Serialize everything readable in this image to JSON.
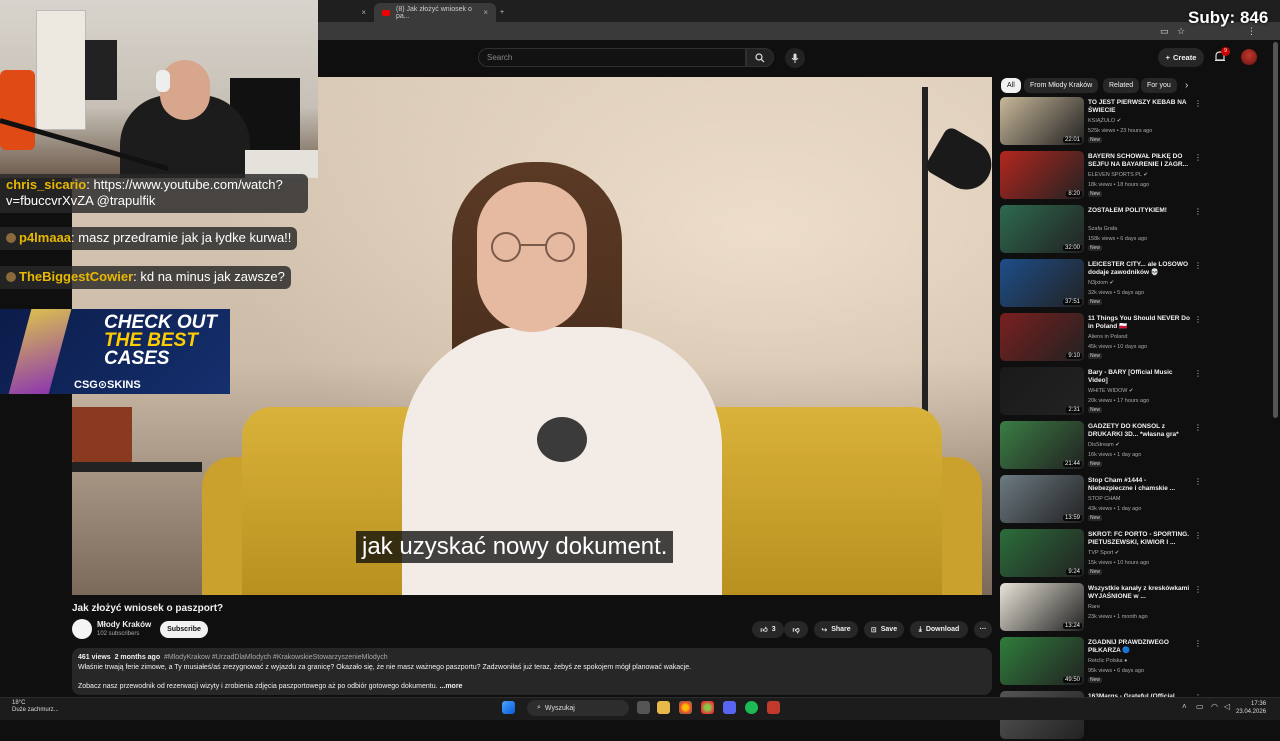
{
  "browser": {
    "tab_active_title": "(8) Jak złożyć wniosek o pa...",
    "tab_close": "×",
    "new_tab": "+"
  },
  "overlay": {
    "subs_counter": "Suby: 846"
  },
  "header": {
    "search_placeholder": "Search",
    "create_label": "Create",
    "notifications_count": "9"
  },
  "video": {
    "subtitle": "jak uzyskać nowy dokument.",
    "title": "Jak złożyć wniosek o paszport?",
    "channel_name": "Młody Kraków",
    "channel_subs": "102 subscribers",
    "subscribe_label": "Subscribe",
    "likes": "3",
    "share_label": "Share",
    "save_label": "Save",
    "download_label": "Download",
    "more_label": "···"
  },
  "description": {
    "views": "461 views",
    "age": "2 months ago",
    "tags": "#MlodyKrakow #UrzadDlaMlodych #KrakowskieStowarzyszenieMlodych",
    "line1": "Właśnie trwają ferie zimowe, a Ty musiałeś/aś zrezygnować z wyjazdu za granicę? Okazało się, że nie masz ważnego paszportu? Zadzwoniłaś już teraz, żebyś ze spokojem mógł planować wakacje.",
    "line2": "Zobacz nasz przewodnik od rezerwacji wizyty i zrobienia zdjęcia paszportowego aż po odbiór gotowego dokumentu.",
    "more": "...more"
  },
  "chat": [
    {
      "user": "chris_sicario",
      "text": ": https://www.youtube.com/watch?v=fbuccvrXvZA @trapulfik"
    },
    {
      "user": "p4lmaaa",
      "text": ": masz przedramie jak ja łydke kurwa!!"
    },
    {
      "user": "TheBiggestCowier",
      "text": ": kd na minus jak zawsze?"
    }
  ],
  "ad": {
    "line1": "CHECK OUT",
    "line2": "THE BEST",
    "line3": "CASES",
    "logo": "CSG⊙SKINS"
  },
  "sidebar": {
    "chips": [
      "All",
      "From Młody Kraków",
      "Related",
      "For you"
    ],
    "videos": [
      {
        "title": "TO JEST PIERWSZY KEBAB NA ŚWIECIE",
        "channel": "KSIĄŻULO ✔",
        "views": "525k views • 23 hours ago",
        "duration": "22:01",
        "badge": "New",
        "color": "#c8b89a"
      },
      {
        "title": "BAYERN SCHOWAŁ PIŁKĘ DO SEJFU NA BAYARENIE I ZAGR...",
        "channel": "ELEVEN SPORTS PL ✔",
        "views": "18k views • 18 hours ago",
        "duration": "8:20",
        "badge": "New",
        "color": "#b3261e"
      },
      {
        "title": "ZOSTAŁEM POLITYKIEM!",
        "channel": "Szafa Grafa",
        "views": "158k views • 6 days ago",
        "duration": "32:00",
        "badge": "New",
        "color": "#2d6a4f"
      },
      {
        "title": "LEICESTER CITY... ale LOSOWO dodaje zawodników 💀",
        "channel": "N3jxiom ✔",
        "views": "32k views • 5 days ago",
        "duration": "37:51",
        "badge": "New",
        "color": "#1d4e89"
      },
      {
        "title": "11 Things You Should NEVER Do in Poland 🇵🇱",
        "channel": "Aliens in Poland",
        "views": "45k views • 10 days ago",
        "duration": "9:10",
        "badge": "New",
        "color": "#7a1f1f"
      },
      {
        "title": "Bary - BARY [Official Music Video]",
        "channel": "WHITE WIDOW ✔",
        "views": "20k views • 17 hours ago",
        "duration": "2:31",
        "badge": "New",
        "color": "#1a1a1a"
      },
      {
        "title": "GADŻETY DO KONSOL z DRUKARKI 3D... *własna gra*",
        "channel": "DisStream ✔",
        "views": "16k views • 1 day ago",
        "duration": "21:44",
        "badge": "New",
        "color": "#3a7d44"
      },
      {
        "title": "Stop Cham #1444 - Niebezpieczne i chamskie ...",
        "channel": "STOP CHAM",
        "views": "43k views • 1 day ago",
        "duration": "13:59",
        "badge": "New",
        "color": "#6c7a82"
      },
      {
        "title": "SKRÓT: FC PORTO - SPORTING. PIETUSZEWSKI, KIWIOR I ...",
        "channel": "TVP Sport ✔",
        "views": "15k views • 10 hours ago",
        "duration": "9:24",
        "badge": "New",
        "color": "#2b6e3a"
      },
      {
        "title": "Wszystkie kanały z kreskówkami WYJAŚNIONE w ...",
        "channel": "Rare",
        "views": "23k views • 1 month ago",
        "duration": "13:24",
        "badge": "",
        "color": "#e9e4d8"
      },
      {
        "title": "ZGADNIJ PRAWDZIWEGO PIŁKARZA 🔵",
        "channel": "Retclic Polska ●",
        "views": "95k views • 6 days ago",
        "duration": "49:50",
        "badge": "New",
        "color": "#2f7d3b"
      },
      {
        "title": "163Margs - Grateful (Official",
        "channel": "",
        "views": "",
        "duration": "",
        "badge": "",
        "color": "#555555"
      }
    ]
  },
  "taskbar": {
    "weather_temp": "18°C",
    "weather_desc": "Duże zachmurz...",
    "search_label": "Wyszukaj",
    "time": "17:36",
    "date": "23.04.2026"
  }
}
